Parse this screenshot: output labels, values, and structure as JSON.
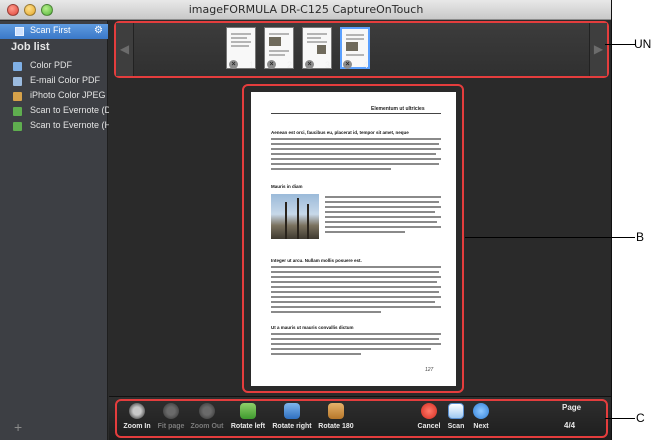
{
  "window": {
    "title": "imageFORMULA DR-C125 CaptureOnTouch"
  },
  "sidebar": {
    "scan_first": "Scan First",
    "joblist_label": "Job list",
    "items": [
      {
        "label": "Color PDF",
        "icon": "folder-icon",
        "color": "#7fb0e6"
      },
      {
        "label": "E-mail Color PDF",
        "icon": "mail-doc-icon",
        "color": "#9bbbe0"
      },
      {
        "label": "iPhoto Color JPEG",
        "icon": "iphoto-icon",
        "color": "#d6a24a"
      },
      {
        "label": "Scan to Evernote (D...",
        "icon": "evernote-icon",
        "color": "#5fae4f"
      },
      {
        "label": "Scan to Evernote (H...",
        "icon": "evernote-icon",
        "color": "#5fae4f"
      }
    ],
    "add_symbol": "+"
  },
  "thumbnails": [
    {
      "number": "1",
      "selected": false
    },
    {
      "number": "2",
      "selected": false
    },
    {
      "number": "3",
      "selected": false
    },
    {
      "number": "4",
      "selected": true
    }
  ],
  "document": {
    "header": "Elementum ut ultricies",
    "headings": [
      "Aenean est orci, faucibus eu, placerat id, tempor sit amet, neque",
      "Mauris in diam",
      "Integer ut arcu. Nullam mollis posuere est.",
      "Ut a mauris ut mauris convallis dictum"
    ],
    "page_number": "127"
  },
  "toolbar": {
    "buttons": [
      {
        "label": "Zoom In",
        "icon": "zoom-in-icon",
        "enabled": true
      },
      {
        "label": "Fit page",
        "icon": "fit-page-icon",
        "enabled": false
      },
      {
        "label": "Zoom Out",
        "icon": "zoom-out-icon",
        "enabled": false
      },
      {
        "label": "Rotate left",
        "icon": "rotate-left-icon",
        "enabled": true
      },
      {
        "label": "Rotate right",
        "icon": "rotate-right-icon",
        "enabled": true
      },
      {
        "label": "Rotate 180",
        "icon": "rotate-180-icon",
        "enabled": true
      },
      {
        "label": "Cancel",
        "icon": "cancel-icon",
        "enabled": true
      },
      {
        "label": "Scan",
        "icon": "scan-icon",
        "enabled": true
      },
      {
        "label": "Next",
        "icon": "next-icon",
        "enabled": true
      }
    ],
    "page_label": "Page",
    "page_count": "4/4"
  },
  "callouts": {
    "a": "UN",
    "b": "B",
    "c": "C"
  },
  "colors": {
    "highlight": "#e43d3d",
    "selection": "#3a78c8"
  }
}
